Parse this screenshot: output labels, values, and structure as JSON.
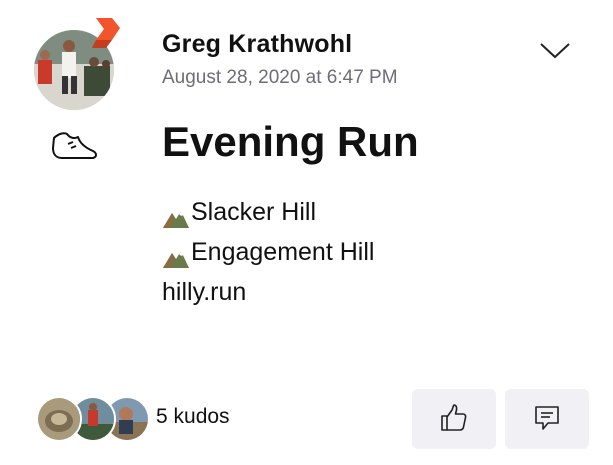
{
  "athlete": {
    "name": "Greg Krathwohl",
    "timestamp": "August 28, 2020 at 6:47 PM",
    "avatar_icon": "athlete-avatar",
    "badge_icon": "subscriber-badge-icon",
    "badge_color": "#f2552c"
  },
  "menu": {
    "icon": "chevron-down-icon"
  },
  "activity": {
    "sport_icon": "running-shoe-icon",
    "title": "Evening Run",
    "description_lines": [
      {
        "icon": "mountain-icon",
        "text": "Slacker Hill"
      },
      {
        "icon": "mountain-icon",
        "text": "Engagement Hill"
      },
      {
        "icon": "",
        "text": "hilly.run"
      }
    ]
  },
  "social": {
    "kudos_label": "5 kudos",
    "kudos_avatar_icons": [
      "kudo-avatar-1",
      "kudo-avatar-2",
      "kudo-avatar-3"
    ],
    "kudos_button_icon": "thumbs-up-icon",
    "comment_button_icon": "comment-icon"
  },
  "colors": {
    "text": "#111111",
    "secondary_text": "#6d6d78",
    "button_bg": "#f0f0f5",
    "brand": "#f2552c"
  }
}
